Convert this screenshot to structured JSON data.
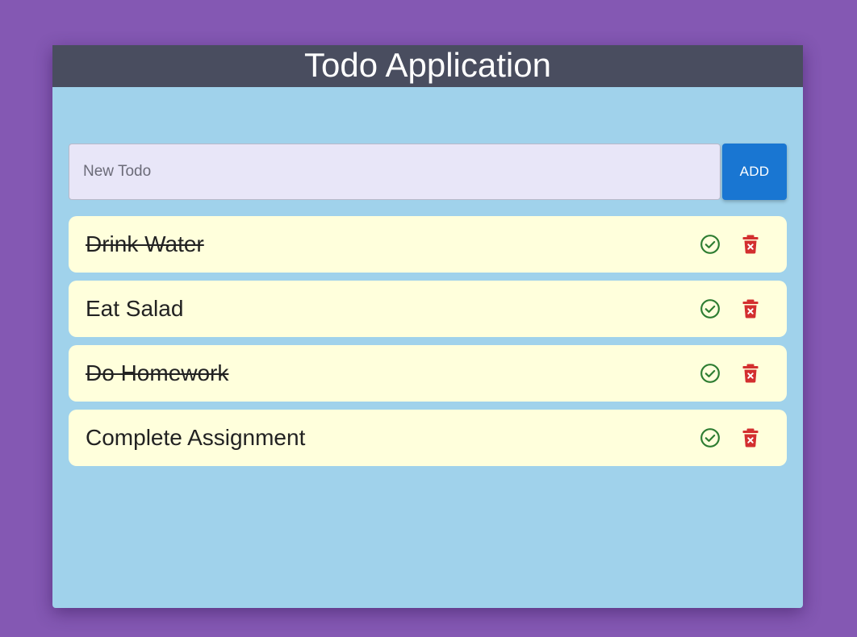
{
  "header": {
    "title": "Todo Application"
  },
  "input": {
    "placeholder": "New Todo",
    "value": ""
  },
  "add_button": {
    "label": "ADD"
  },
  "todos": [
    {
      "text": "Drink Water",
      "completed": true
    },
    {
      "text": "Eat Salad",
      "completed": false
    },
    {
      "text": "Do Homework",
      "completed": true
    },
    {
      "text": "Complete Assignment",
      "completed": false
    }
  ],
  "icons": {
    "complete": "check-circle-icon",
    "delete": "trash-icon"
  },
  "colors": {
    "background": "#8458b3",
    "card": "#a0d2eb",
    "header": "#494d5f",
    "input": "#e8e6f8",
    "add_button": "#1976d2",
    "item": "#ffffdc",
    "complete_icon": "#2e7d32",
    "delete_icon": "#d32f2f"
  }
}
